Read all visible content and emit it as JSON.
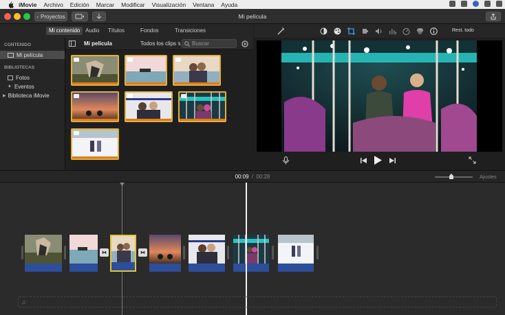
{
  "menubar": {
    "items": [
      "iMovie",
      "Archivo",
      "Edición",
      "Marcar",
      "Modificar",
      "Visualización",
      "Ventana",
      "Ayuda"
    ]
  },
  "titlebar": {
    "projects_label": "Proyectos",
    "title": "Mi película"
  },
  "library_tabs": [
    "Mi contenido",
    "Audio",
    "Títulos",
    "Fondos",
    "Transiciones"
  ],
  "sidebar": {
    "content_header": "CONTENIDO",
    "movie_item": "Mi película",
    "libraries_header": "BIBLIOTECAS",
    "items": [
      "Fotos",
      "Eventos"
    ],
    "library_item": "Biblioteca iMovie"
  },
  "browser": {
    "title": "Mi película",
    "filter": "Todos los clips",
    "search_placeholder": "Buscar"
  },
  "viewer": {
    "reset_label": "Rest. todo"
  },
  "time": {
    "current": "00:09",
    "separator": "/",
    "total": "00:28",
    "settings_label": "Ajustes"
  },
  "icons": {
    "apple": "apple-icon",
    "back": "chevron-left-icon",
    "magic": "magic-wand-icon",
    "share": "share-icon",
    "mic": "microphone-icon",
    "play": "play-icon",
    "fullscreen": "fullscreen-icon",
    "music": "music-note-icon"
  },
  "colors": {
    "accent_selection": "#e2b03a",
    "audio_track": "#2d4e9a",
    "clip_range": "#e07a1e"
  }
}
